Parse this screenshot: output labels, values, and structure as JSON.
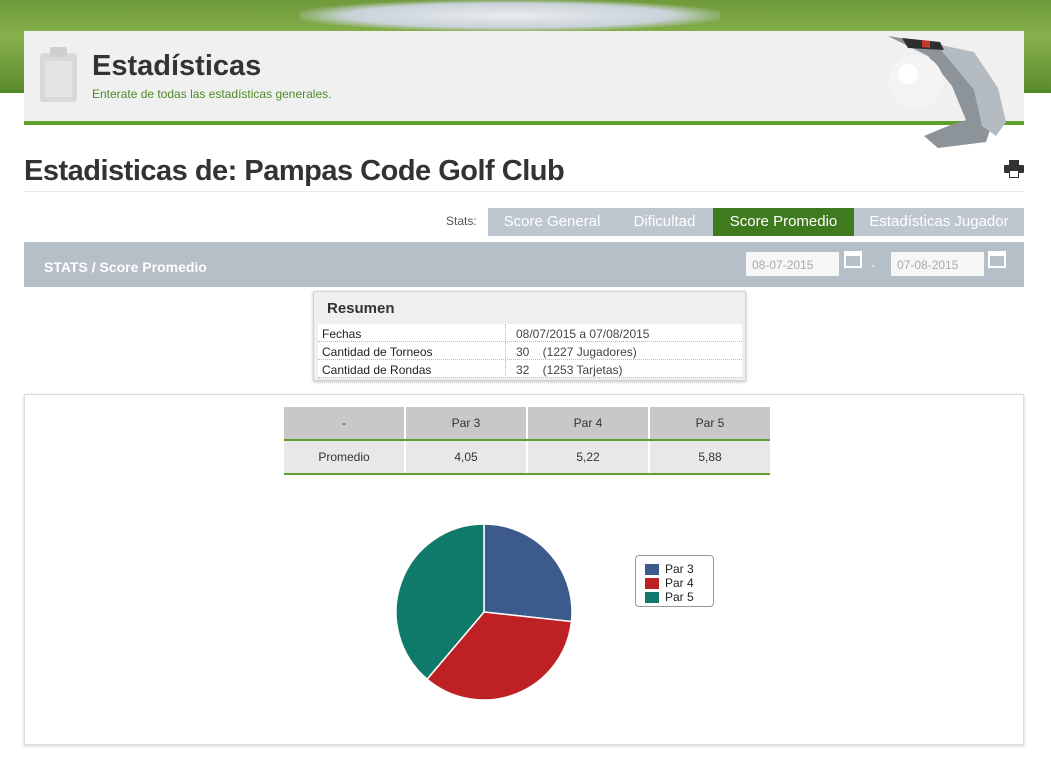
{
  "header": {
    "title": "Estadísticas",
    "subtitle": "Enterate de todas las estadísticas generales."
  },
  "page": {
    "title": "Estadisticas de: Pampas Code Golf Club"
  },
  "tabs": {
    "prefix": "Stats:",
    "items": [
      {
        "label": "Score General",
        "active": false
      },
      {
        "label": "Dificultad",
        "active": false
      },
      {
        "label": "Score Promedio",
        "active": true
      },
      {
        "label": "Estadísticas Jugador",
        "active": false
      }
    ]
  },
  "stats_bar": {
    "title": "STATS / Score Promedio",
    "date_from": "08-07-2015",
    "date_to": "07-08-2015",
    "separator": "-"
  },
  "resumen": {
    "title": "Resumen",
    "rows": [
      {
        "label": "Fechas",
        "value": "08/07/2015 a 07/08/2015"
      },
      {
        "label": "Cantidad de Torneos",
        "value": "30    (1227 Jugadores)"
      },
      {
        "label": "Cantidad de Rondas",
        "value": "32    (1253 Tarjetas)"
      }
    ]
  },
  "table": {
    "headers": [
      "-",
      "Par 3",
      "Par 4",
      "Par 5"
    ],
    "rows": [
      [
        "Promedio",
        "4,05",
        "5,22",
        "5,88"
      ]
    ]
  },
  "colors": {
    "accent_green": "#5fa02a",
    "active_tab": "#3f7a1f",
    "par3": "#3d5a8c",
    "par4": "#bd2124",
    "par5": "#0f7a6a"
  },
  "chart_data": {
    "type": "pie",
    "categories": [
      "Par 3",
      "Par 4",
      "Par 5"
    ],
    "values": [
      4.05,
      5.22,
      5.88
    ],
    "legend": [
      "Par 3",
      "Par 4",
      "Par 5"
    ],
    "legend_position": "right"
  }
}
